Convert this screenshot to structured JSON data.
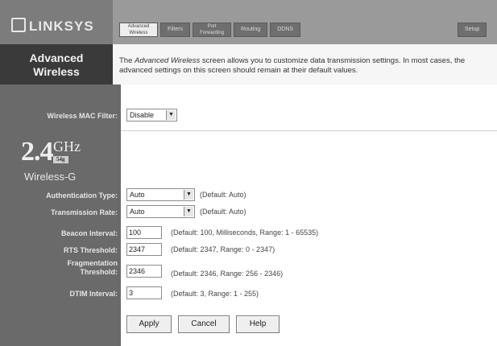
{
  "header": {
    "logo": "LINKSYS",
    "tabs": [
      {
        "label": "Advanced Wireless"
      },
      {
        "label": "Filters"
      },
      {
        "label": "Port Forwarding"
      },
      {
        "label": "Routing"
      },
      {
        "label": "DDNS"
      }
    ],
    "setup_tab": "Setup"
  },
  "title": {
    "section": "Advanced Wireless",
    "description_lead": "The ",
    "description_em": "Advanced Wireless",
    "description_tail": " screen allows you to customize data transmission settings. In most cases, the advanced settings on this screen should remain at their default values."
  },
  "mac_filter": {
    "label": "Wireless MAC Filter:",
    "value": "Disable"
  },
  "brand": {
    "number": "2.4",
    "unit": "GHz",
    "badge": "54g",
    "name": "Wireless-G"
  },
  "fields": {
    "auth_type": {
      "label": "Authentication Type:",
      "value": "Auto",
      "hint": "(Default: Auto)"
    },
    "tx_rate": {
      "label": "Transmission Rate:",
      "value": "Auto",
      "hint": "(Default: Auto)"
    },
    "beacon": {
      "label": "Beacon Interval:",
      "value": "100",
      "hint": "(Default: 100, Milliseconds, Range: 1 - 65535)"
    },
    "rts": {
      "label": "RTS Threshold:",
      "value": "2347",
      "hint": "(Default: 2347, Range: 0 - 2347)"
    },
    "frag_line1": "Fragmentation",
    "frag_line2": "Threshold:",
    "frag": {
      "value": "2346",
      "hint": "(Default: 2346, Range: 256 - 2346)"
    },
    "dtim": {
      "label": "DTIM Interval:",
      "value": "3",
      "hint": "(Default: 3, Range: 1 - 255)"
    }
  },
  "buttons": {
    "apply": "Apply",
    "cancel": "Cancel",
    "help": "Help"
  },
  "colors": {
    "sidebar": "#6a6a6a",
    "header": "#9a9a9a",
    "title": "#3a3a3a"
  }
}
